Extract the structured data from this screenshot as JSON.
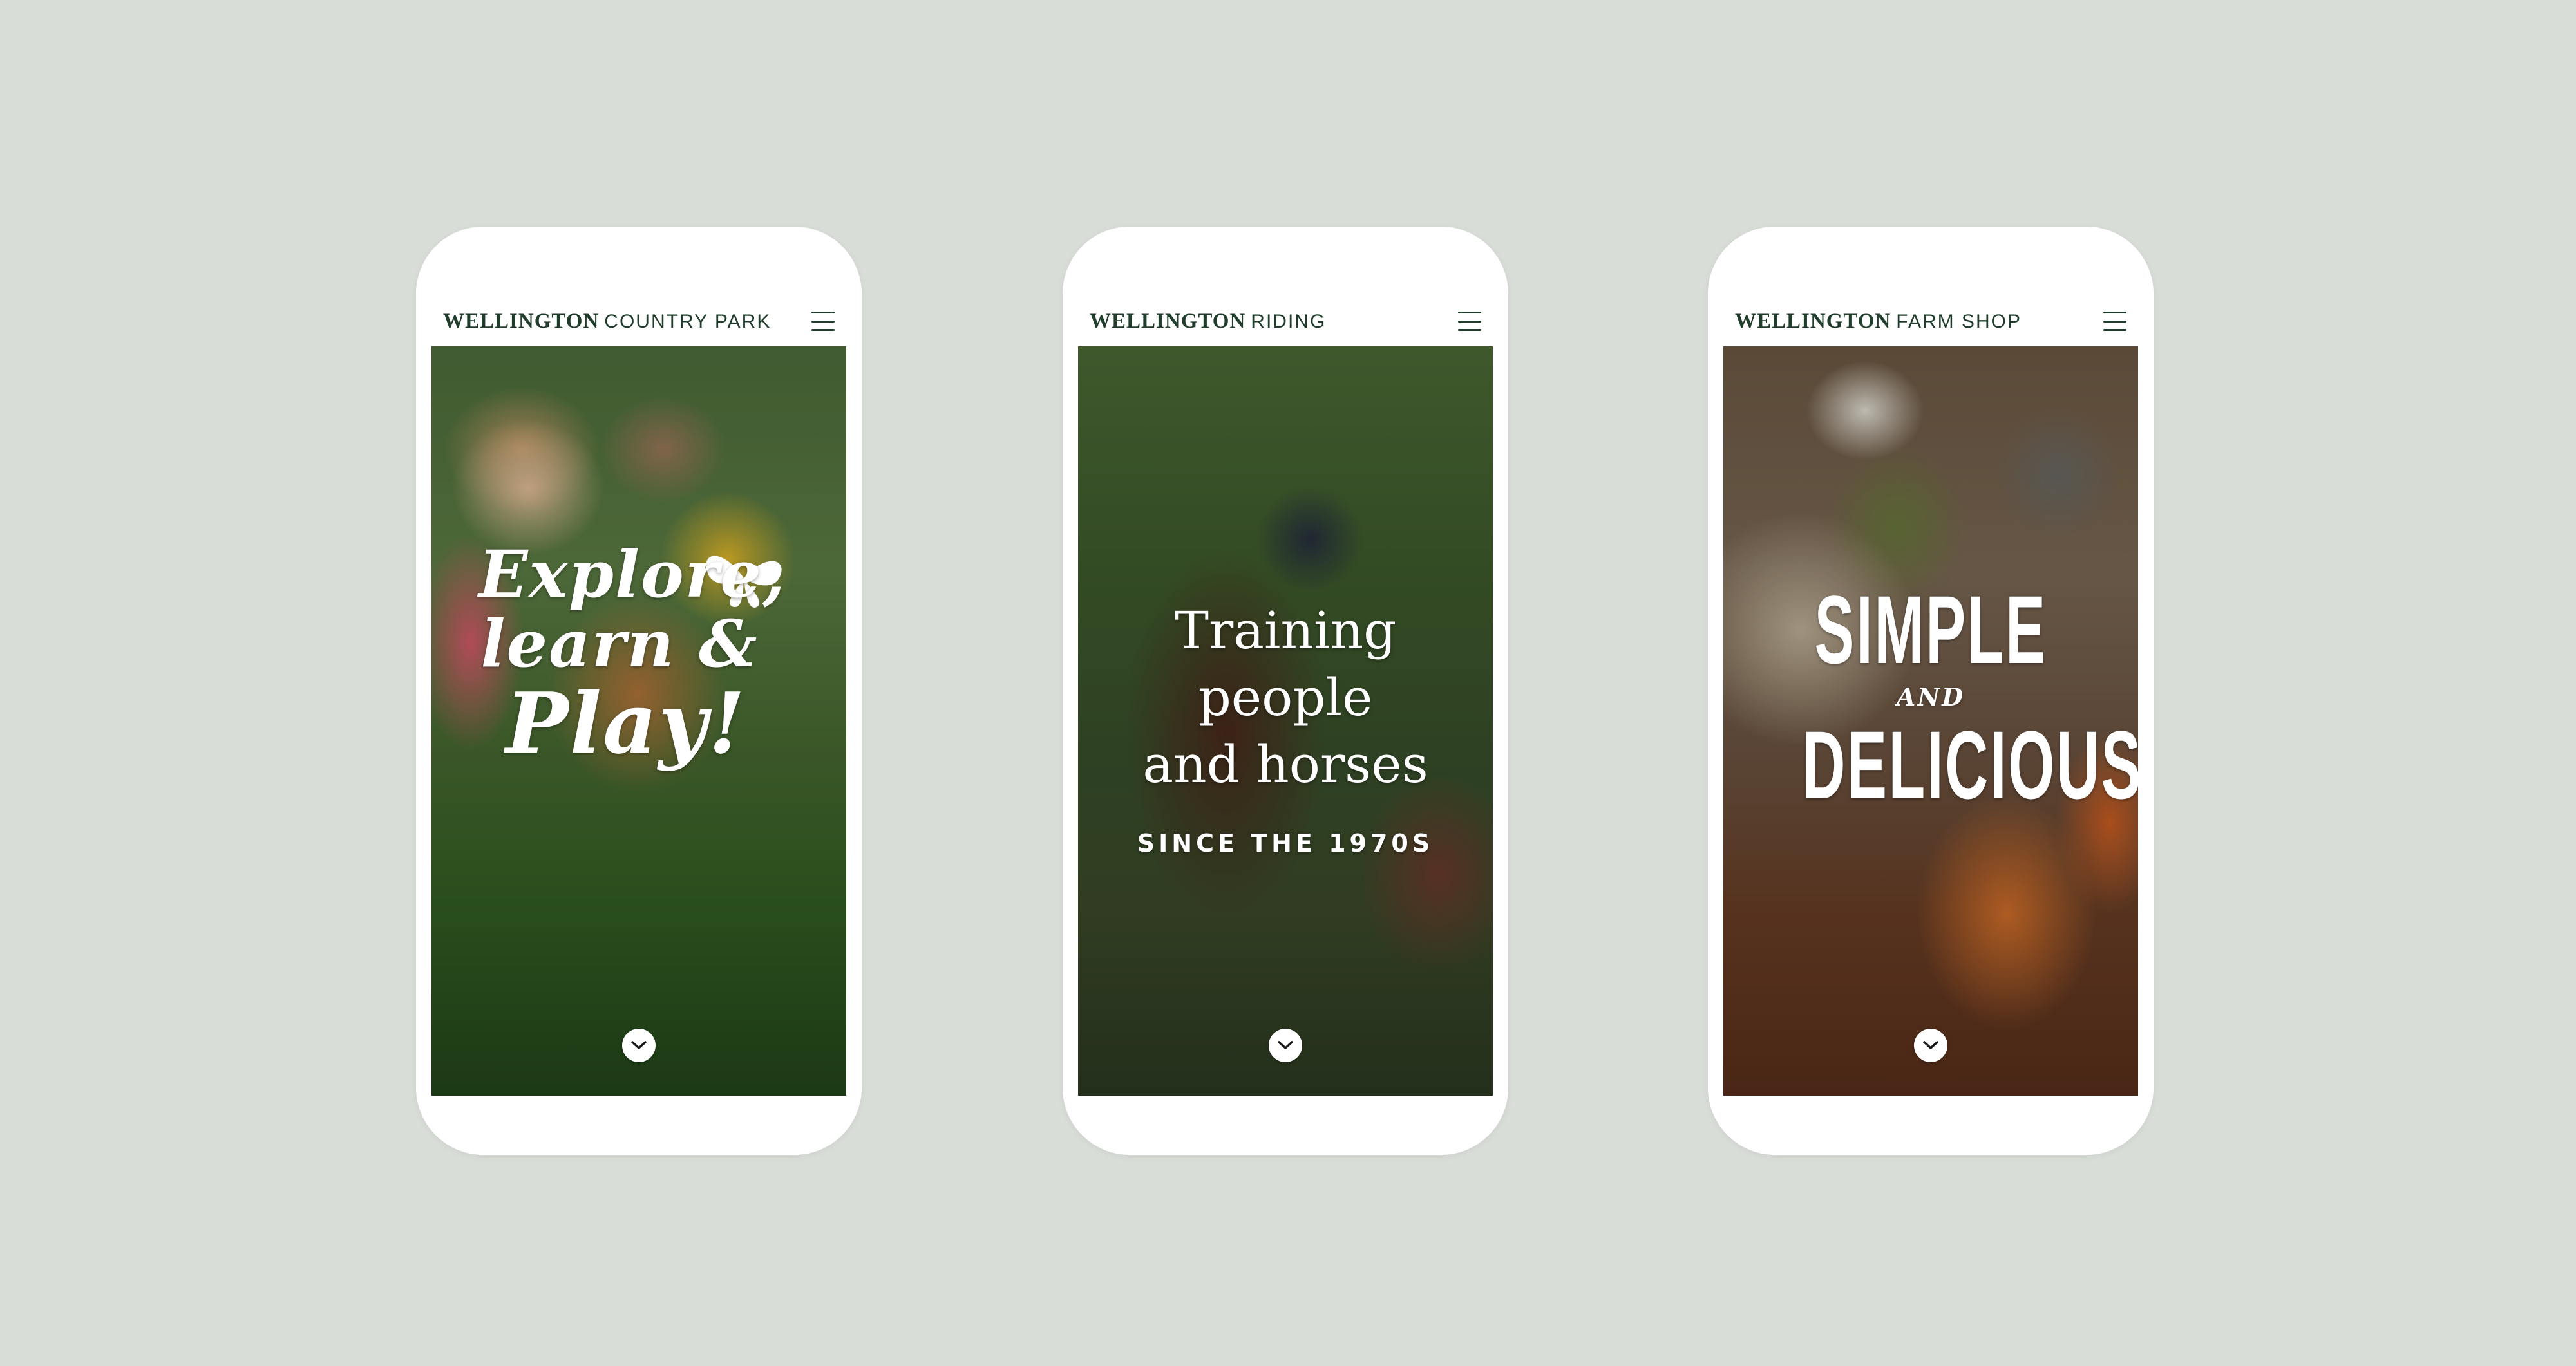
{
  "phones": [
    {
      "brand_bold": "WELLINGTON",
      "brand_sub": "COUNTRY PARK",
      "hero_lines": [
        "Explore,",
        "learn &",
        "Play!"
      ],
      "menu_icon": "hamburger-menu-icon",
      "scroll_icon": "chevron-down-icon"
    },
    {
      "brand_bold": "WELLINGTON",
      "brand_sub": "RIDING",
      "hero_lines": [
        "Training",
        "people",
        "and horses"
      ],
      "hero_sub": "SINCE THE 1970S",
      "menu_icon": "hamburger-menu-icon",
      "scroll_icon": "chevron-down-icon"
    },
    {
      "brand_bold": "WELLINGTON",
      "brand_sub": "FARM SHOP",
      "hero_lines": [
        "SIMPLE",
        "AND",
        "DELICIOUS"
      ],
      "menu_icon": "hamburger-menu-icon",
      "scroll_icon": "chevron-down-icon"
    }
  ],
  "colors": {
    "background": "#d9ddd8",
    "brand_text": "#1f3d2a",
    "hero_text": "#ffffff"
  }
}
